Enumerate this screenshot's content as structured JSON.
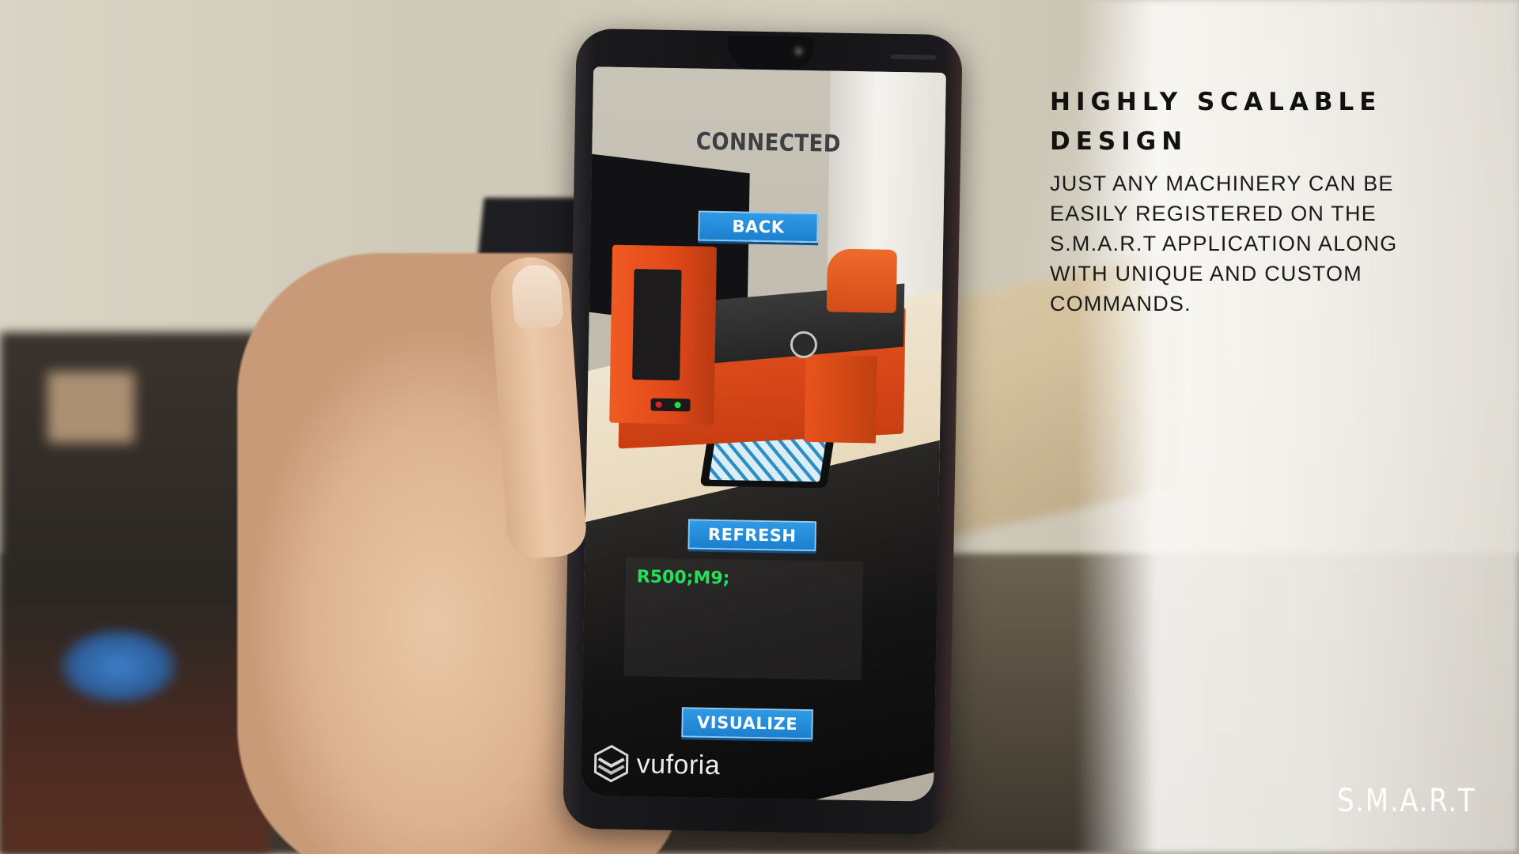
{
  "ar_app": {
    "status_label": "CONNECTED",
    "back_button": "BACK",
    "refresh_button": "REFRESH",
    "visualize_button": "VISUALIZE",
    "command_log": "R500;M9;",
    "vuforia_logo_text": "vuforia",
    "button_color": "#1c7fcf",
    "log_text_color": "#22e05a"
  },
  "slide": {
    "headline": "HIGHLY SCALABLE DESIGN",
    "body": "JUST ANY MACHINERY CAN BE EASILY REGISTERED ON THE S.M.A.R.T APPLICATION ALONG WITH UNIQUE AND CUSTOM COMMANDS.",
    "brand": "S.M.A.R.T"
  },
  "icons": {
    "vuforia": "vuforia-cube-icon"
  }
}
